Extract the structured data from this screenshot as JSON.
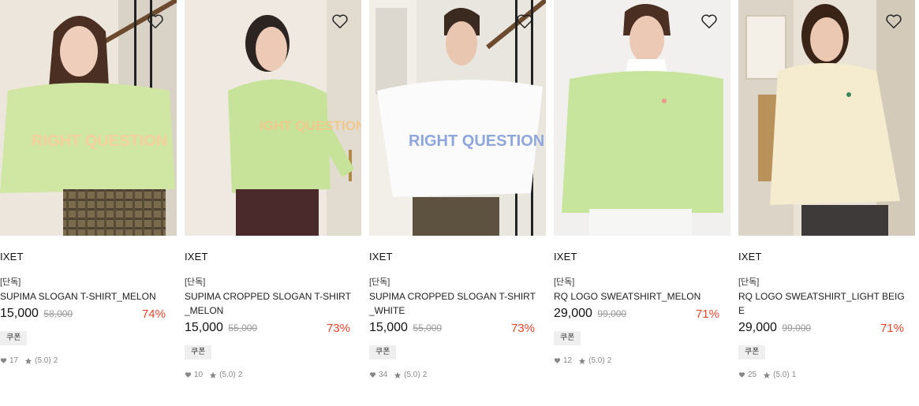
{
  "products": [
    {
      "brand": "IXET",
      "tag": "[단독]",
      "name": "SUPIMA SLOGAN T-SHIRT_MELON",
      "price": "15,000",
      "original_price": "58,000",
      "discount": "74%",
      "coupon": "쿠폰",
      "likes": "17",
      "rating": "(5.0)",
      "reviews": "2"
    },
    {
      "brand": "IXET",
      "tag": "[단독]",
      "name": "SUPIMA CROPPED SLOGAN T-SHIRT_MELON",
      "price": "15,000",
      "original_price": "55,000",
      "discount": "73%",
      "coupon": "쿠폰",
      "likes": "10",
      "rating": "(5.0)",
      "reviews": "2"
    },
    {
      "brand": "IXET",
      "tag": "[단독]",
      "name": "SUPIMA CROPPED SLOGAN T-SHIRT_WHITE",
      "price": "15,000",
      "original_price": "55,000",
      "discount": "73%",
      "coupon": "쿠폰",
      "likes": "34",
      "rating": "(5.0)",
      "reviews": "2"
    },
    {
      "brand": "IXET",
      "tag": "[단독]",
      "name": "RQ LOGO SWEATSHIRT_MELON",
      "price": "29,000",
      "original_price": "99,000",
      "discount": "71%",
      "coupon": "쿠폰",
      "likes": "12",
      "rating": "(5.0)",
      "reviews": "2"
    },
    {
      "brand": "IXET",
      "tag": "[단독]",
      "name": "RQ LOGO SWEATSHIRT_LIGHT BEIGE",
      "price": "29,000",
      "original_price": "99,000",
      "discount": "71%",
      "coupon": "쿠폰",
      "likes": "25",
      "rating": "(5.0)",
      "reviews": "1"
    }
  ],
  "colors": {
    "discount": "#e8452b",
    "original_price": "#999999",
    "coupon_bg": "#efefef"
  },
  "icons": {
    "wishlist": "heart-outline-icon",
    "likes": "heart-filled-icon",
    "rating": "star-icon"
  }
}
